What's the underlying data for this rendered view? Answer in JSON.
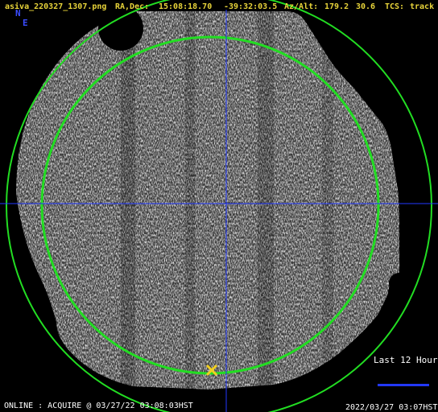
{
  "header": {
    "filename": "asiva_220327_1307.png",
    "radec_label": "RA,Dec:",
    "ra": "15:08:18.70",
    "dec": "-39:32:03.5",
    "azalt_label": "Az/Alt:",
    "az": "179.2",
    "alt": "30.6",
    "tcs_label": "TCS:",
    "tcs_status": "track"
  },
  "compass": {
    "north": "N",
    "east": "E"
  },
  "legend": {
    "label": "Last 12 Hours",
    "color": "#2238ff"
  },
  "footer": {
    "status": "ONLINE : ACQUIRE @ 03/27/22 03:08:03HST",
    "timestamp": "2022/03/27 03:07HST"
  },
  "colors": {
    "header_text": "#e8d43a",
    "circle": "#22dd22",
    "crosshair": "#2238ff",
    "target_marker": "#f2d020"
  },
  "icons": {
    "target_marker": "x-cross-icon"
  }
}
